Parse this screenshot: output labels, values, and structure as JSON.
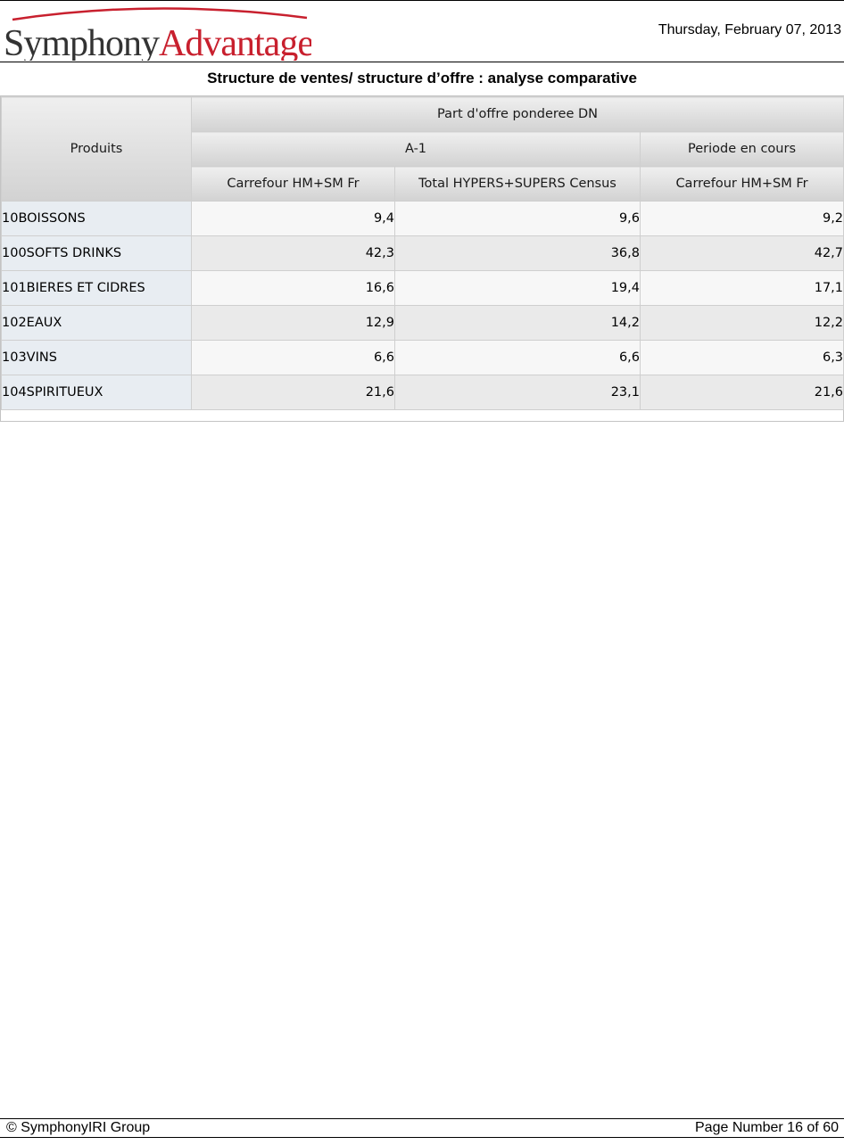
{
  "header": {
    "logo_text_part1": "Symphony",
    "logo_text_part2": "Advantage",
    "date": "Thursday, February 07, 2013"
  },
  "report": {
    "title": "Structure de ventes/ structure d’offre : analyse comparative"
  },
  "table": {
    "row_header": "Produits",
    "measure": "Part d'offre ponderee DN",
    "periods": [
      "A-1",
      "Periode en cours"
    ],
    "columns": [
      "Carrefour HM+SM Fr",
      "Total HYPERS+SUPERS Census",
      "Carrefour HM+SM Fr"
    ],
    "rows": [
      {
        "product": "10BOISSONS",
        "values": [
          "9,4",
          "9,6",
          "9,2"
        ]
      },
      {
        "product": "100SOFTS DRINKS",
        "values": [
          "42,3",
          "36,8",
          "42,7"
        ]
      },
      {
        "product": "101BIERES ET CIDRES",
        "values": [
          "16,6",
          "19,4",
          "17,1"
        ]
      },
      {
        "product": "102EAUX",
        "values": [
          "12,9",
          "14,2",
          "12,2"
        ]
      },
      {
        "product": "103VINS",
        "values": [
          "6,6",
          "6,6",
          "6,3"
        ]
      },
      {
        "product": "104SPIRITUEUX",
        "values": [
          "21,6",
          "23,1",
          "21,6"
        ]
      }
    ]
  },
  "footer": {
    "copyright": "© SymphonyIRI Group",
    "page_number": "Page Number 16 of 60"
  },
  "colors": {
    "logo_dark": "#333333",
    "logo_red": "#c8202e",
    "product_cell_bg": "#e8edf2",
    "header_gradient_top": "#efefef",
    "header_gradient_bottom": "#d2d2d2"
  }
}
